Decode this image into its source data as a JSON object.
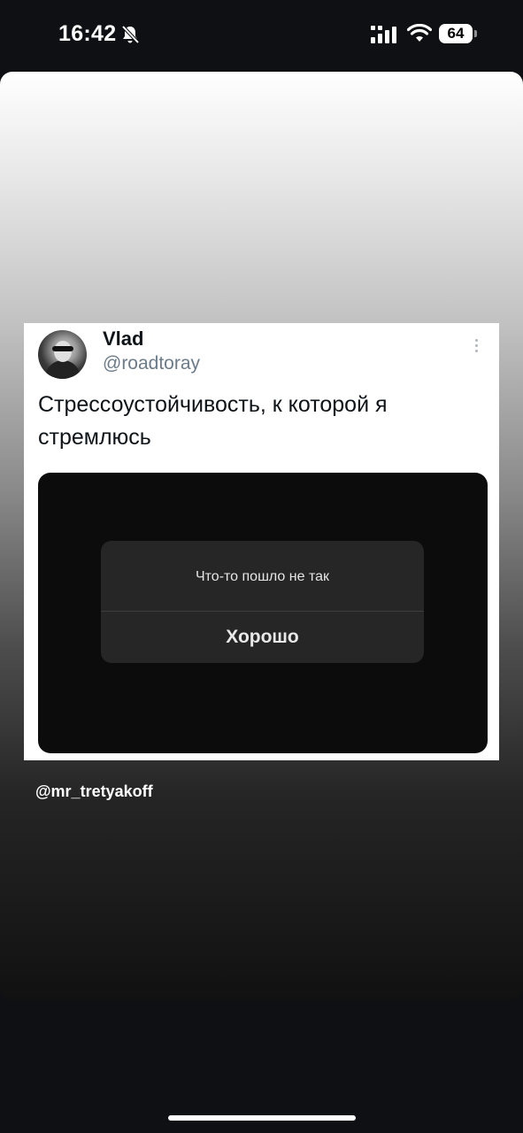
{
  "status_bar": {
    "time": "16:42",
    "battery_level": "64",
    "icons": [
      "bell-off-icon",
      "signal-icon",
      "wifi-icon",
      "battery-icon"
    ]
  },
  "tweet": {
    "display_name": "Vlad",
    "handle": "@roadtoray",
    "text": "Стрессоустойчивость, к которой я стремлюсь",
    "media_alert": {
      "title": "Что-то пошло не так",
      "button_label": "Хорошо"
    }
  },
  "caption": "@mr_tretyakoff"
}
